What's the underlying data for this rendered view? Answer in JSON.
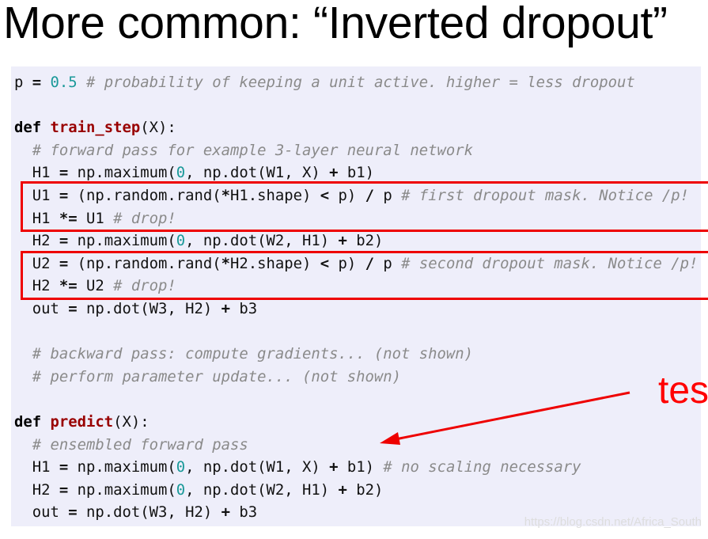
{
  "title": "More common: “Inverted dropout”",
  "annotation": "tes",
  "watermark": "https://blog.csdn.net/Africa_South",
  "colors": {
    "highlight_box": "#ee0000",
    "arrow": "#ee0000",
    "code_background": "#eeeefa",
    "keyword": "#000000",
    "function_name": "#990000",
    "number": "#1a9999",
    "comment": "#8a8a8a"
  },
  "code_lines": [
    [
      [
        "tx",
        "p "
      ],
      [
        "op",
        "="
      ],
      [
        "tx",
        " "
      ],
      [
        "num",
        "0.5"
      ],
      [
        "tx",
        " "
      ],
      [
        "cm",
        "# probability of keeping a unit active. higher = less dropout"
      ]
    ],
    [],
    [
      [
        "kw",
        "def"
      ],
      [
        "tx",
        " "
      ],
      [
        "fn",
        "train_step"
      ],
      [
        "tx",
        "(X):"
      ]
    ],
    [
      [
        "tx",
        "  "
      ],
      [
        "cm",
        "# forward pass for example 3-layer neural network"
      ]
    ],
    [
      [
        "tx",
        "  H1 "
      ],
      [
        "op",
        "="
      ],
      [
        "tx",
        " np.maximum("
      ],
      [
        "num",
        "0"
      ],
      [
        "tx",
        ", np.dot(W1, X) "
      ],
      [
        "op",
        "+"
      ],
      [
        "tx",
        " b1)"
      ]
    ],
    [
      [
        "tx",
        "  U1 "
      ],
      [
        "op",
        "="
      ],
      [
        "tx",
        " (np.random.rand("
      ],
      [
        "op",
        "*"
      ],
      [
        "tx",
        "H1.shape) "
      ],
      [
        "op",
        "<"
      ],
      [
        "tx",
        " p) "
      ],
      [
        "op",
        "/"
      ],
      [
        "tx",
        " p "
      ],
      [
        "cm",
        "# first dropout mask. Notice /p!"
      ]
    ],
    [
      [
        "tx",
        "  H1 "
      ],
      [
        "op",
        "*="
      ],
      [
        "tx",
        " U1 "
      ],
      [
        "cm",
        "# drop!"
      ]
    ],
    [
      [
        "tx",
        "  H2 "
      ],
      [
        "op",
        "="
      ],
      [
        "tx",
        " np.maximum("
      ],
      [
        "num",
        "0"
      ],
      [
        "tx",
        ", np.dot(W2, H1) "
      ],
      [
        "op",
        "+"
      ],
      [
        "tx",
        " b2)"
      ]
    ],
    [
      [
        "tx",
        "  U2 "
      ],
      [
        "op",
        "="
      ],
      [
        "tx",
        " (np.random.rand("
      ],
      [
        "op",
        "*"
      ],
      [
        "tx",
        "H2.shape) "
      ],
      [
        "op",
        "<"
      ],
      [
        "tx",
        " p) "
      ],
      [
        "op",
        "/"
      ],
      [
        "tx",
        " p "
      ],
      [
        "cm",
        "# second dropout mask. Notice /p!"
      ]
    ],
    [
      [
        "tx",
        "  H2 "
      ],
      [
        "op",
        "*="
      ],
      [
        "tx",
        " U2 "
      ],
      [
        "cm",
        "# drop!"
      ]
    ],
    [
      [
        "tx",
        "  out "
      ],
      [
        "op",
        "="
      ],
      [
        "tx",
        " np.dot(W3, H2) "
      ],
      [
        "op",
        "+"
      ],
      [
        "tx",
        " b3"
      ]
    ],
    [],
    [
      [
        "tx",
        "  "
      ],
      [
        "cm",
        "# backward pass: compute gradients... (not shown)"
      ]
    ],
    [
      [
        "tx",
        "  "
      ],
      [
        "cm",
        "# perform parameter update... (not shown)"
      ]
    ],
    [],
    [
      [
        "kw",
        "def"
      ],
      [
        "tx",
        " "
      ],
      [
        "fn",
        "predict"
      ],
      [
        "tx",
        "(X):"
      ]
    ],
    [
      [
        "tx",
        "  "
      ],
      [
        "cm",
        "# ensembled forward pass"
      ]
    ],
    [
      [
        "tx",
        "  H1 "
      ],
      [
        "op",
        "="
      ],
      [
        "tx",
        " np.maximum("
      ],
      [
        "num",
        "0"
      ],
      [
        "tx",
        ", np.dot(W1, X) "
      ],
      [
        "op",
        "+"
      ],
      [
        "tx",
        " b1) "
      ],
      [
        "cm",
        "# no scaling necessary"
      ]
    ],
    [
      [
        "tx",
        "  H2 "
      ],
      [
        "op",
        "="
      ],
      [
        "tx",
        " np.maximum("
      ],
      [
        "num",
        "0"
      ],
      [
        "tx",
        ", np.dot(W2, H1) "
      ],
      [
        "op",
        "+"
      ],
      [
        "tx",
        " b2)"
      ]
    ],
    [
      [
        "tx",
        "  out "
      ],
      [
        "op",
        "="
      ],
      [
        "tx",
        " np.dot(W3, H2) "
      ],
      [
        "op",
        "+"
      ],
      [
        "tx",
        " b3"
      ]
    ]
  ]
}
